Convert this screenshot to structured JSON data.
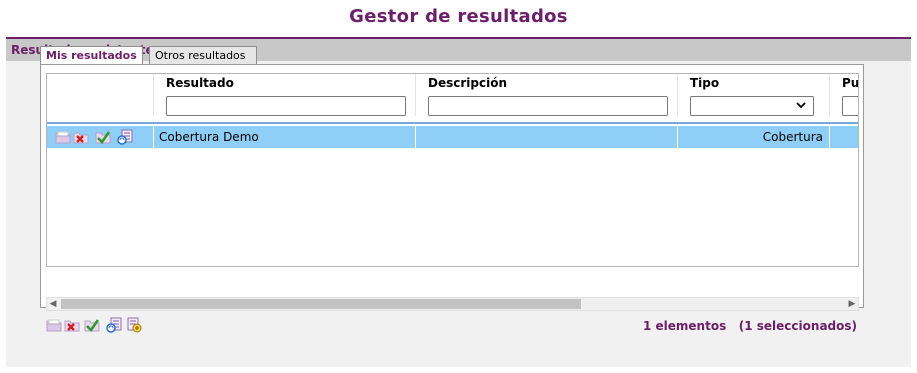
{
  "page": {
    "title": "Gestor de resultados"
  },
  "panel": {
    "header": "Resultados existentes"
  },
  "tabs": [
    {
      "label": "Mis resultados",
      "active": true
    },
    {
      "label": "Otros resultados",
      "active": false
    }
  ],
  "grid": {
    "columns": [
      "",
      "Resultado",
      "Descripción",
      "Tipo",
      "Pu"
    ],
    "rows": [
      {
        "resultado": "Cobertura Demo",
        "descripcion": "",
        "tipo": "Cobertura",
        "selected": true
      }
    ],
    "filters": {
      "tipo_selected": ""
    },
    "row_icons": [
      "folder-icon",
      "delete-icon",
      "check-icon",
      "list-refresh-icon"
    ]
  },
  "footer": {
    "icons": [
      "folder-icon",
      "delete-icon",
      "check-icon",
      "list-refresh-icon",
      "list-edit-icon"
    ],
    "count_text": "1 elementos",
    "selected_text": "(1 seleccionados)"
  },
  "colors": {
    "brand": "#6b2069",
    "selection": "#8fcff7",
    "header_bg": "#c8c8c8"
  }
}
